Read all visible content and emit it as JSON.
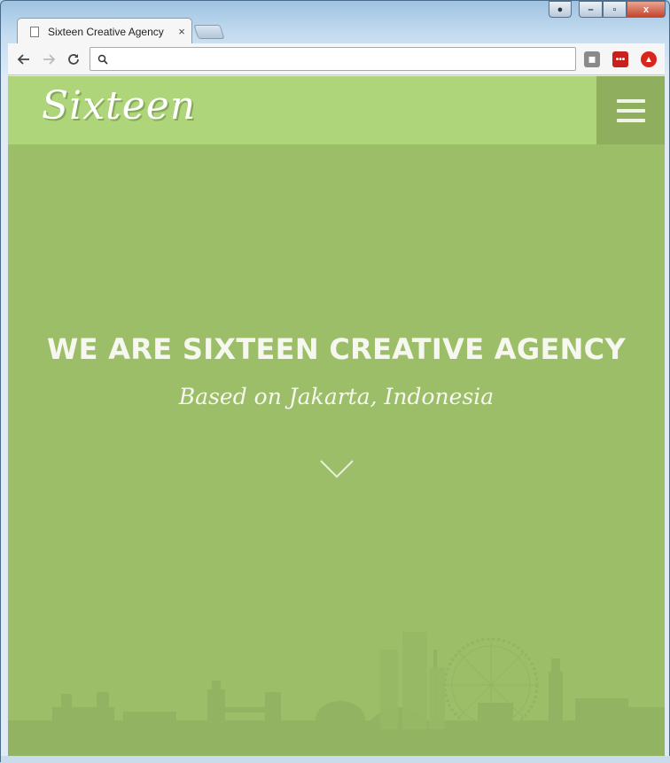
{
  "browser": {
    "tab_title": "Sixteen Creative Agency",
    "tab_close": "×",
    "url": "",
    "caption": {
      "minimize": "–",
      "maximize": "▫",
      "close": "x"
    }
  },
  "site": {
    "logo": "Sixteen",
    "hero": {
      "title": "WE ARE SIXTEEN CREATIVE AGENCY",
      "subtitle": "Based on Jakarta, Indonesia"
    },
    "colors": {
      "header_bg": "#aed57a",
      "hero_bg": "#9cbe68",
      "menu_bg": "#8fae5e"
    }
  },
  "icons": {
    "back": "arrow-left-icon",
    "forward": "arrow-right-icon",
    "reload": "reload-icon",
    "search": "search-icon",
    "menu": "hamburger-menu-icon",
    "scroll_down": "chevron-down-icon"
  }
}
